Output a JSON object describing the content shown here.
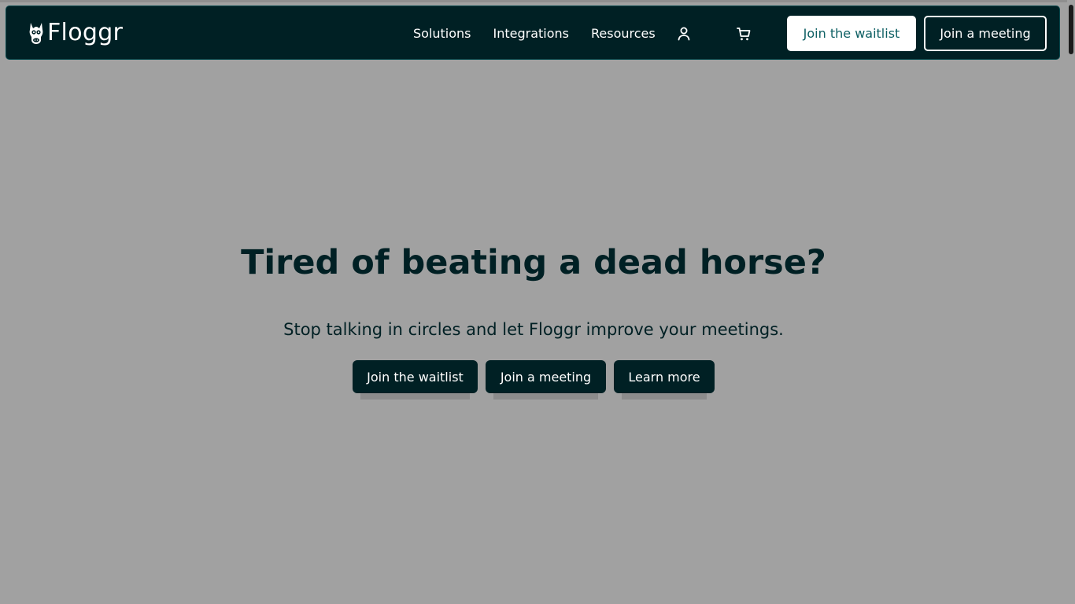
{
  "brand": {
    "name": "Floggr",
    "logo_icon": "horse-head-icon"
  },
  "nav": {
    "links": [
      "Solutions",
      "Integrations",
      "Resources"
    ],
    "account_icon": "user-icon",
    "cart_icon": "cart-icon",
    "waitlist_label": "Join the waitlist",
    "meeting_label": "Join a meeting"
  },
  "hero": {
    "title": "Tired of beating a dead horse?",
    "subtitle": "Stop talking in circles and let Floggr improve your meetings.",
    "buttons": [
      "Join the waitlist",
      "Join a meeting",
      "Learn more"
    ]
  },
  "colors": {
    "page_background": "#a1a1a1",
    "navbar_background": "#002024",
    "accent_text": "#0d5f63",
    "hero_text": "#002024",
    "button_background": "#002024"
  }
}
